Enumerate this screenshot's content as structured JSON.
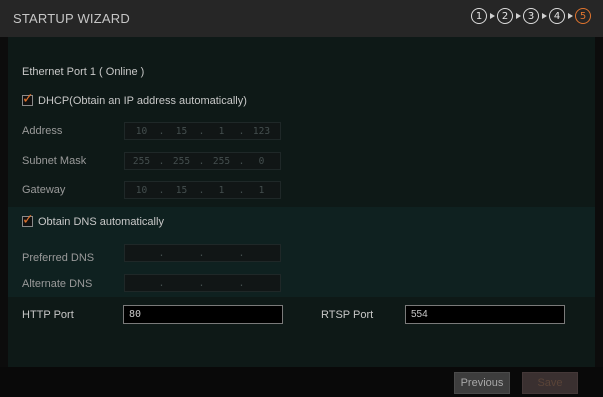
{
  "header": {
    "title": "STARTUP WIZARD",
    "steps": [
      "1",
      "2",
      "3",
      "4",
      "5"
    ],
    "active_step": "5"
  },
  "network": {
    "port_label": "Ethernet Port 1 ( Online )",
    "dhcp_label": "DHCP(Obtain an IP address automatically)",
    "dhcp_checked": true,
    "address_label": "Address",
    "address": [
      "10",
      "15",
      "1",
      "123"
    ],
    "subnet_label": "Subnet Mask",
    "subnet": [
      "255",
      "255",
      "255",
      "0"
    ],
    "gateway_label": "Gateway",
    "gateway": [
      "10",
      "15",
      "1",
      "1"
    ],
    "dns_auto_label": "Obtain DNS automatically",
    "dns_auto_checked": true,
    "preferred_dns_label": "Preferred DNS",
    "preferred_dns": [
      "",
      "",
      "",
      ""
    ],
    "alternate_dns_label": "Alternate DNS",
    "alternate_dns": [
      "",
      "",
      "",
      ""
    ],
    "http_port_label": "HTTP Port",
    "http_port": "80",
    "rtsp_port_label": "RTSP Port",
    "rtsp_port": "554"
  },
  "footer": {
    "previous_label": "Previous",
    "save_label": "Save"
  },
  "colors": {
    "accent": "#e0742e",
    "background": "#0c0c0c",
    "panel": "#0e1917"
  }
}
